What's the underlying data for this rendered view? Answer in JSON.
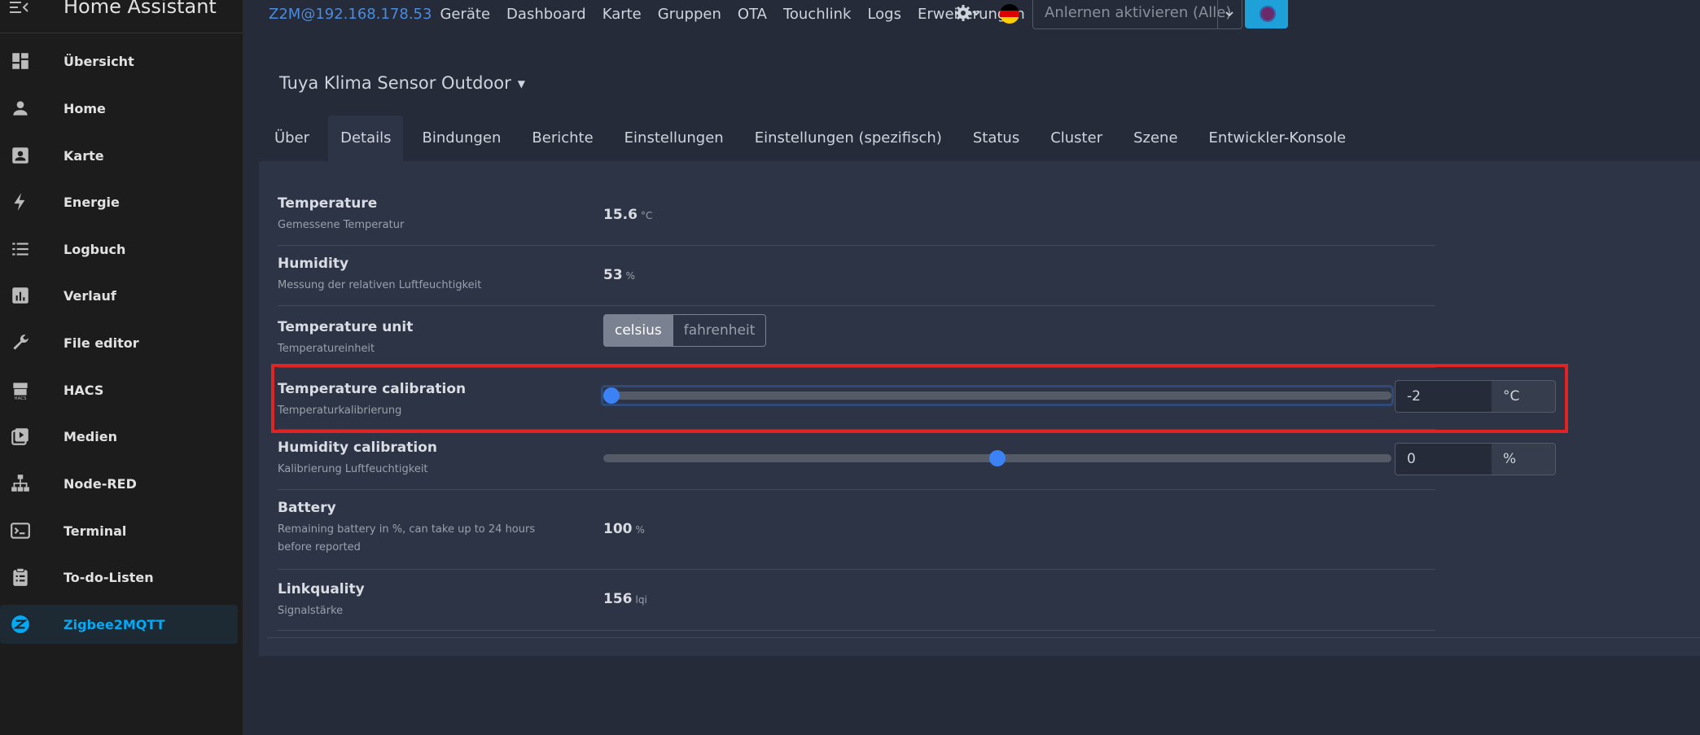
{
  "sidebar": {
    "title": "Home Assistant",
    "items": [
      {
        "label": "Übersicht",
        "icon": "dashboard-icon"
      },
      {
        "label": "Home",
        "icon": "person-icon"
      },
      {
        "label": "Karte",
        "icon": "map-icon"
      },
      {
        "label": "Energie",
        "icon": "lightning-icon"
      },
      {
        "label": "Logbuch",
        "icon": "list-icon"
      },
      {
        "label": "Verlauf",
        "icon": "chart-icon"
      },
      {
        "label": "File editor",
        "icon": "wrench-icon"
      },
      {
        "label": "HACS",
        "icon": "hacs-icon"
      },
      {
        "label": "Medien",
        "icon": "media-icon"
      },
      {
        "label": "Node-RED",
        "icon": "sitemap-icon"
      },
      {
        "label": "Terminal",
        "icon": "terminal-icon"
      },
      {
        "label": "To-do-Listen",
        "icon": "clipboard-icon"
      },
      {
        "label": "Zigbee2MQTT",
        "icon": "zigbee-icon"
      }
    ],
    "active_item": "Zigbee2MQTT"
  },
  "topnav": {
    "brand": "Z2M@192.168.178.53",
    "items": [
      "Geräte",
      "Dashboard",
      "Karte",
      "Gruppen",
      "OTA",
      "Touchlink",
      "Logs",
      "Erweiterungen"
    ],
    "join_select": "Anlernen aktivieren (Alle)"
  },
  "device": {
    "title": "Tuya Klima Sensor Outdoor"
  },
  "tabs": [
    "Über",
    "Details",
    "Bindungen",
    "Berichte",
    "Einstellungen",
    "Einstellungen (spezifisch)",
    "Status",
    "Cluster",
    "Szene",
    "Entwickler-Konsole"
  ],
  "active_tab": "Details",
  "rows": {
    "temperature": {
      "name": "Temperature",
      "desc": "Gemessene Temperatur",
      "value": "15.6",
      "unit": "°C"
    },
    "humidity": {
      "name": "Humidity",
      "desc": "Messung der relativen Luftfeuchtigkeit",
      "value": "53",
      "unit": "%"
    },
    "temperature_unit": {
      "name": "Temperature unit",
      "desc": "Temperatureinheit",
      "options": [
        "celsius",
        "fahrenheit"
      ],
      "selected": "celsius"
    },
    "temperature_calibration": {
      "name": "Temperature calibration",
      "desc": "Temperaturkalibrierung",
      "value": "-2",
      "unit": "°C",
      "slider_fraction": 0.0
    },
    "humidity_calibration": {
      "name": "Humidity calibration",
      "desc": "Kalibrierung Luftfeuchtigkeit",
      "value": "0",
      "unit": "%",
      "slider_fraction": 0.5
    },
    "battery": {
      "name": "Battery",
      "desc": "Remaining battery in %, can take up to 24 hours before reported",
      "value": "100",
      "unit": "%"
    },
    "linkquality": {
      "name": "Linkquality",
      "desc": "Signalstärke",
      "value": "156",
      "unit": "lqi"
    }
  },
  "colors": {
    "accent": "#03a9f4",
    "link": "#4a8cdf",
    "slider": "#3b82f6",
    "highlight": "#e02424"
  }
}
